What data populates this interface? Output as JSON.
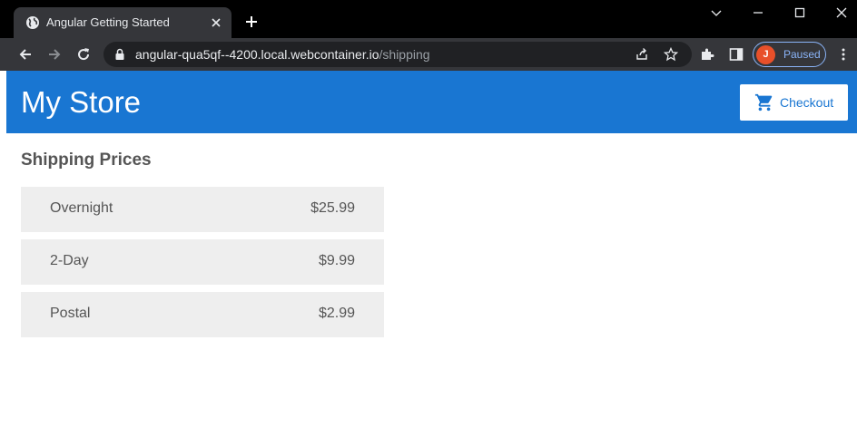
{
  "browser": {
    "tab": {
      "title": "Angular Getting Started",
      "favicon": "globe-icon"
    },
    "address": {
      "host": "angular-qua5qf--4200.local.webcontainer.io",
      "path": "/shipping"
    },
    "profile": {
      "initial": "J",
      "status": "Paused",
      "avatar_color": "#e8502a"
    }
  },
  "app": {
    "title": "My Store",
    "checkout_label": "Checkout",
    "brand_color": "#1976d2"
  },
  "page": {
    "heading": "Shipping Prices",
    "shipping": [
      {
        "type": "Overnight",
        "price": "$25.99"
      },
      {
        "type": "2-Day",
        "price": "$9.99"
      },
      {
        "type": "Postal",
        "price": "$2.99"
      }
    ]
  }
}
